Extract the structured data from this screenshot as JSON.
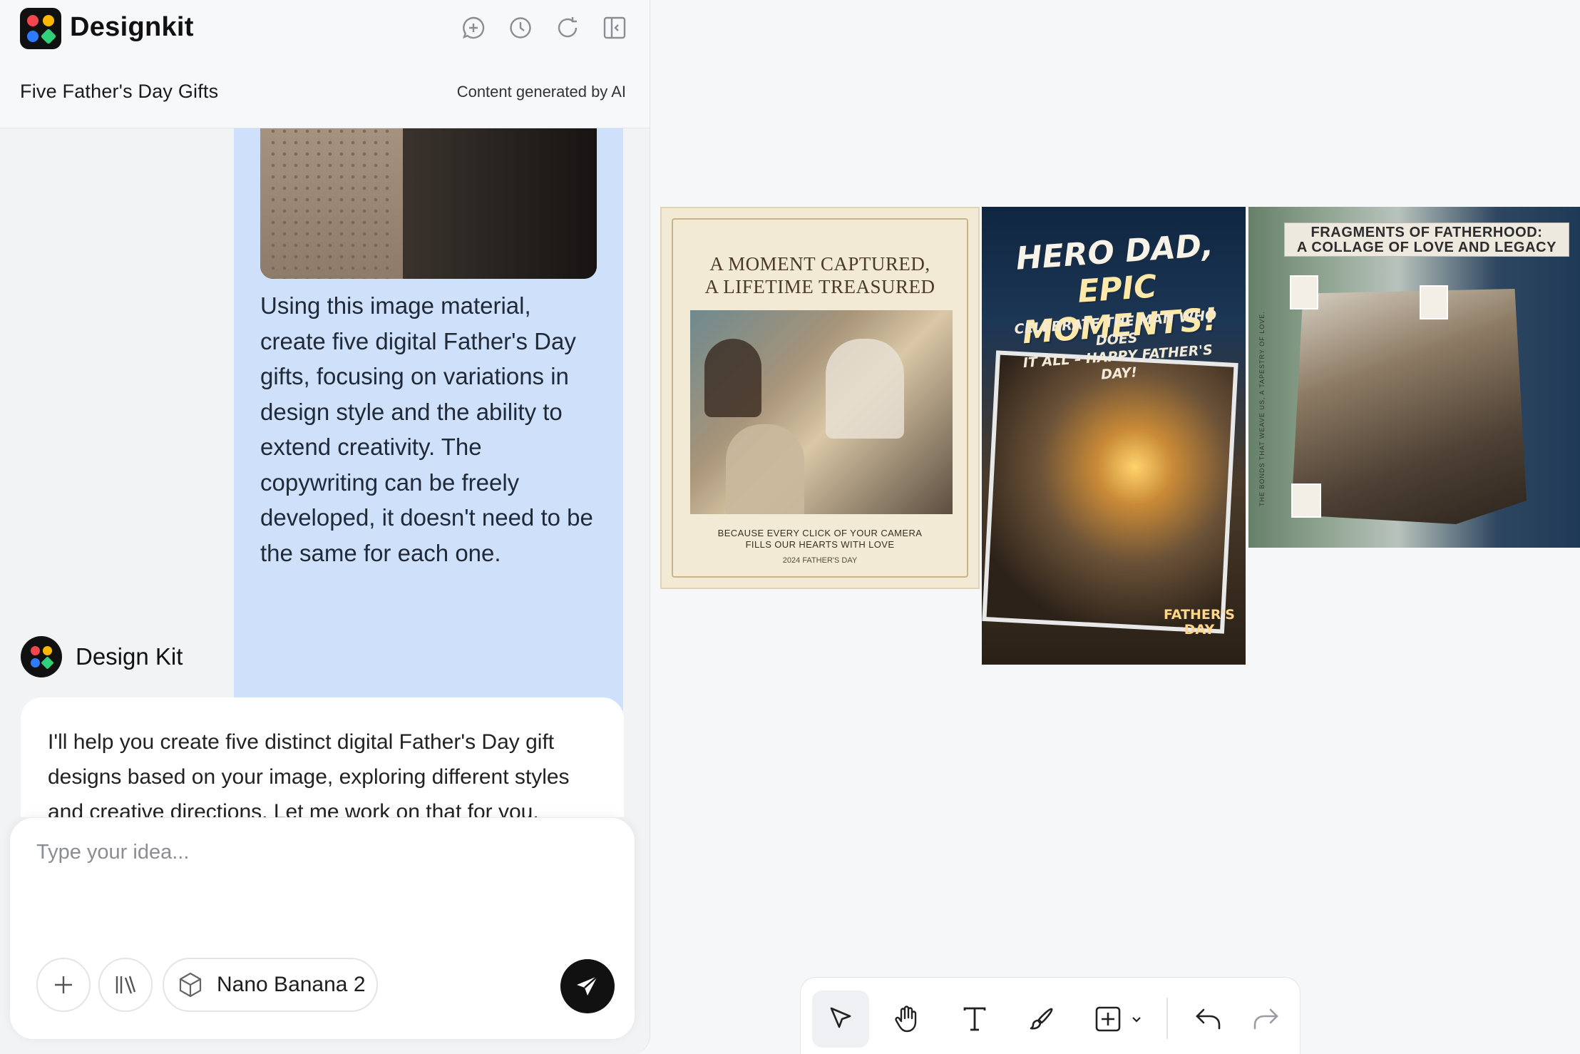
{
  "app": {
    "name": "Designkit"
  },
  "header": {
    "project_title": "Five Father's Day Gifts",
    "ai_note": "Content generated by AI",
    "icons": [
      "new-chat-icon",
      "history-icon",
      "refresh-icon",
      "collapse-panel-icon"
    ]
  },
  "chat": {
    "user_message": "Using this image material, create five digital Father's Day gifts, focusing on variations in design style and the ability to extend creativity. The copywriting can be freely developed, it doesn't need to be the same for each one.",
    "bot_name": "Design Kit",
    "bot_message": "I'll help you create five distinct digital Father's Day gift designs based on your image, exploring different styles and creative directions. Let me work on that for you."
  },
  "composer": {
    "placeholder": "Type your idea...",
    "value": "",
    "model_label": "Nano Banana 2"
  },
  "canvas": {
    "card1": {
      "headline_line1": "A MOMENT CAPTURED,",
      "headline_line2": "A LIFETIME TREASURED",
      "caption_line1": "BECAUSE EVERY CLICK OF YOUR CAMERA",
      "caption_line2": "FILLS OUR HEARTS WITH LOVE",
      "year": "2024 FATHER'S DAY"
    },
    "card2": {
      "headline_line1": "HERO DAD,",
      "headline_line2": "EPIC MOMENTS!",
      "sub_line1": "CELEBRATE THE MAN WHO DOES",
      "sub_line2": "IT ALL – HAPPY FATHER'S DAY!",
      "badge_line1": "FATHER'S",
      "badge_line2": "DAY"
    },
    "card3": {
      "title_line1": "FRAGMENTS OF FATHERHOOD:",
      "title_line2": "A COLLAGE OF LOVE AND LEGACY",
      "vertical_text": "THE BONDS THAT WEAVE US, A TAPESTRY OF LOVE."
    }
  },
  "toolbar": {
    "tools": [
      "select-icon",
      "hand-icon",
      "text-icon",
      "brush-icon",
      "add-shape-icon",
      "undo-icon",
      "redo-icon"
    ]
  },
  "colors": {
    "user_bubble": "#cfe0fb",
    "send_button": "#111111",
    "logo_dots": [
      "#f3464f",
      "#ffb800",
      "#2f7bff",
      "#31d17c"
    ]
  }
}
